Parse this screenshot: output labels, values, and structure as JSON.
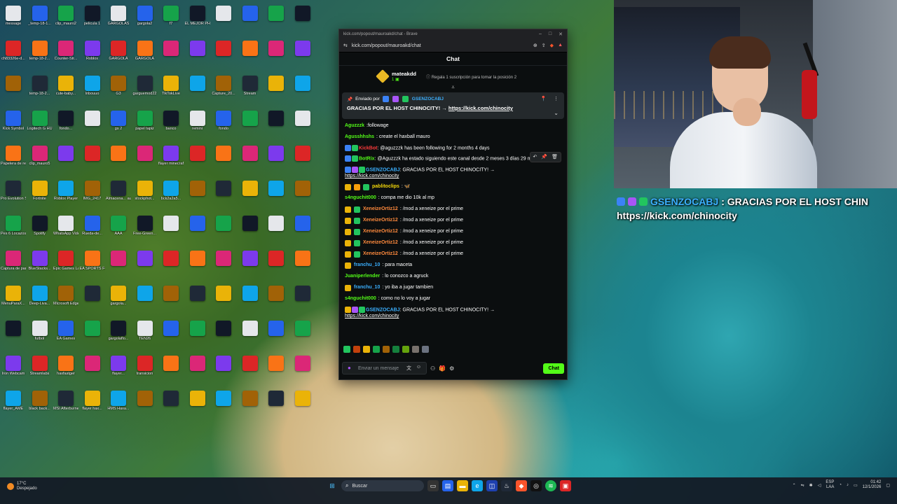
{
  "desktop": {
    "icons": [
      [
        "message",
        "_temp-18-1...",
        "clip_mauro2",
        "pelicula 1",
        "GARGOLAS",
        "gargola2",
        "f7",
        "EL MEJOR PHONK",
        "",
        "",
        "",
        ""
      ],
      [
        "ch83326e-d...",
        "temp-18-2...",
        "Counter-Str...",
        "Roblox",
        "GARGOLA",
        "GARGOLA",
        "",
        "",
        "",
        "",
        "",
        ""
      ],
      [
        "",
        "temp-18-2...",
        "cute-baby...",
        "Inbouuo",
        "G3",
        "garguemod22",
        "TikTokLive",
        "",
        "Capture_20...",
        "Stream",
        "",
        ""
      ],
      [
        "Kick Symbol",
        "Logitech G HUB",
        "fondo...",
        "",
        "gs 2",
        "papel tapiz",
        "banco",
        "remini",
        "fondo",
        "",
        "",
        ""
      ],
      [
        "Papelera de reciclaje",
        "clip_mauro5",
        "",
        "",
        "",
        "",
        "flayer minecraft",
        "",
        "",
        "",
        "",
        ""
      ],
      [
        "Pro Evolution Soccer 6",
        "Fortnite",
        "Roblox Player",
        "IMG_2417",
        "Almacena... automatic",
        "stockphot...",
        "bck2a2a5...",
        "",
        "",
        "",
        "",
        ""
      ],
      [
        "Pes 6 Locazos",
        "Spotify",
        "WhatsApp Video 2025...",
        "Rueda-de...",
        "AAA",
        "Free-Green...",
        "",
        "",
        "",
        "",
        "",
        ""
      ],
      [
        "Captura de pantalla ...",
        "BlueStacks...",
        "Epic Games Launcher",
        "EA SPORTS FC 26",
        "",
        "",
        "",
        "",
        "",
        "",
        "",
        ""
      ],
      [
        "MenuParaX...",
        "Deep-Liva...",
        "Microsoft Edge",
        "",
        "gargola...",
        "",
        "",
        "",
        "",
        "",
        "",
        ""
      ],
      [
        "",
        "futbol",
        "EA Games",
        "",
        "gargolaflo...",
        "TEN26",
        "",
        "",
        "",
        "",
        "",
        ""
      ],
      [
        "Iron Webcam",
        "Streamlabs",
        "haxfastger",
        "",
        "flayer...",
        "transicion",
        "",
        "",
        "",
        "",
        "",
        ""
      ],
      [
        "flayer_AME",
        "black back...",
        "MSI Afterburner",
        "flayer hax...",
        "HMS Haxa...",
        "",
        "",
        "",
        "",
        "",
        "",
        ""
      ]
    ]
  },
  "taskbar": {
    "weather_temp": "17°C",
    "weather_desc": "Despejado",
    "search_label": "Buscar",
    "lang_1": "ESP",
    "lang_2": "LAA",
    "time": "01:42",
    "date": "12/1/2026"
  },
  "browser": {
    "tab_title": "kick.com/popout/mauroakd/chat - Brave",
    "url": "kick.com/popout/mauroakd/chat"
  },
  "chat": {
    "header": "Chat",
    "top_sub": {
      "name": "mateakdd",
      "count": "1",
      "tip": "Regala 1 suscripción para tomar la posición 2"
    },
    "pinned": {
      "sent_by_label": "Enviado por",
      "sender": "GSENZOCABJ",
      "text": "GRACIAS POR EL HOST CHINOCITY! → ",
      "link": "https://kick.com/chinocity"
    },
    "messages": [
      {
        "user": "Aguzzzk",
        "color": "#53fc18",
        "text": ":followage",
        "badges": []
      },
      {
        "user": "Agusshhshs",
        "color": "#53fc18",
        "text": ": create el haxball mauro",
        "badges": []
      },
      {
        "user": "KickBot",
        "color": "#ff3b3b",
        "text": ": @aguzzzk has been following for 2 months 4 days",
        "badges": [
          "#3b82f6",
          "#22c55e"
        ]
      },
      {
        "user": "BotRix",
        "color": "#53fc18",
        "text": ": @Aguzzzk ha estado siguiendo este canal desde 2 meses 3 días 29 minutos !",
        "badges": [
          "#3b82f6",
          "#22c55e"
        ]
      },
      {
        "user": "GSENZOCABJ",
        "color": "#3bb0ff",
        "text": ": GRACIAS POR EL HOST CHINOCITY! → ",
        "link": "https://kick.com/chinocity",
        "badges": [
          "#3b82f6",
          "#a855f7",
          "#22c55e"
        ]
      },
      {
        "user": "pablitoclips",
        "color": "#f5d90a",
        "text": ": 🦋",
        "badges": [
          "#eab308",
          "#f59e0b",
          "#22c55e"
        ]
      },
      {
        "user": "s4nguchit000",
        "color": "#53fc18",
        "text": ": compa me dio 10k al mp",
        "badges": []
      },
      {
        "user": "XeneizeOrtiz12",
        "color": "#ff8a3d",
        "text": ": /mod a xeneize por el prime",
        "badges": [
          "#eab308",
          "#22c55e"
        ]
      },
      {
        "user": "XeneizeOrtiz12",
        "color": "#ff8a3d",
        "text": ": /mod a xeneize por el prime",
        "badges": [
          "#eab308",
          "#22c55e"
        ]
      },
      {
        "user": "XeneizeOrtiz12",
        "color": "#ff8a3d",
        "text": ": /mod a xeneize por el prime",
        "badges": [
          "#eab308",
          "#22c55e"
        ]
      },
      {
        "user": "XeneizeOrtiz12",
        "color": "#ff8a3d",
        "text": ": /mod a xeneize por el prime",
        "badges": [
          "#eab308",
          "#22c55e"
        ]
      },
      {
        "user": "XeneizeOrtiz12",
        "color": "#ff8a3d",
        "text": ": /mod a xeneize por el prime",
        "badges": [
          "#eab308",
          "#22c55e"
        ]
      },
      {
        "user": "franchu_10",
        "color": "#3bb0ff",
        "text": ": para maceta",
        "badges": [
          "#eab308"
        ]
      },
      {
        "user": "Juaniperlender",
        "color": "#53fc18",
        "text": ": lo conozco a agruck",
        "badges": []
      },
      {
        "user": "franchu_10",
        "color": "#3bb0ff",
        "text": ": yo iba a jugar tambien",
        "badges": [
          "#eab308"
        ]
      },
      {
        "user": "s4nguchit000",
        "color": "#53fc18",
        "text": ": como no lo voy a jugar",
        "badges": []
      },
      {
        "user": "GSENZOCABJ",
        "color": "#3bb0ff",
        "text": ": GRACIAS POR EL HOST CHINOCITY! → ",
        "link": "https://kick.com/chinocity",
        "badges": [
          "#eab308",
          "#a855f7",
          "#22c55e"
        ]
      }
    ],
    "input_placeholder": "Enviar un mensaje",
    "send_label": "Chat"
  },
  "overlay": {
    "user": "GSENZOCABJ",
    "text": ": GRACIAS POR EL HOST CHIN",
    "link": "https://kick.com/chinocity"
  }
}
